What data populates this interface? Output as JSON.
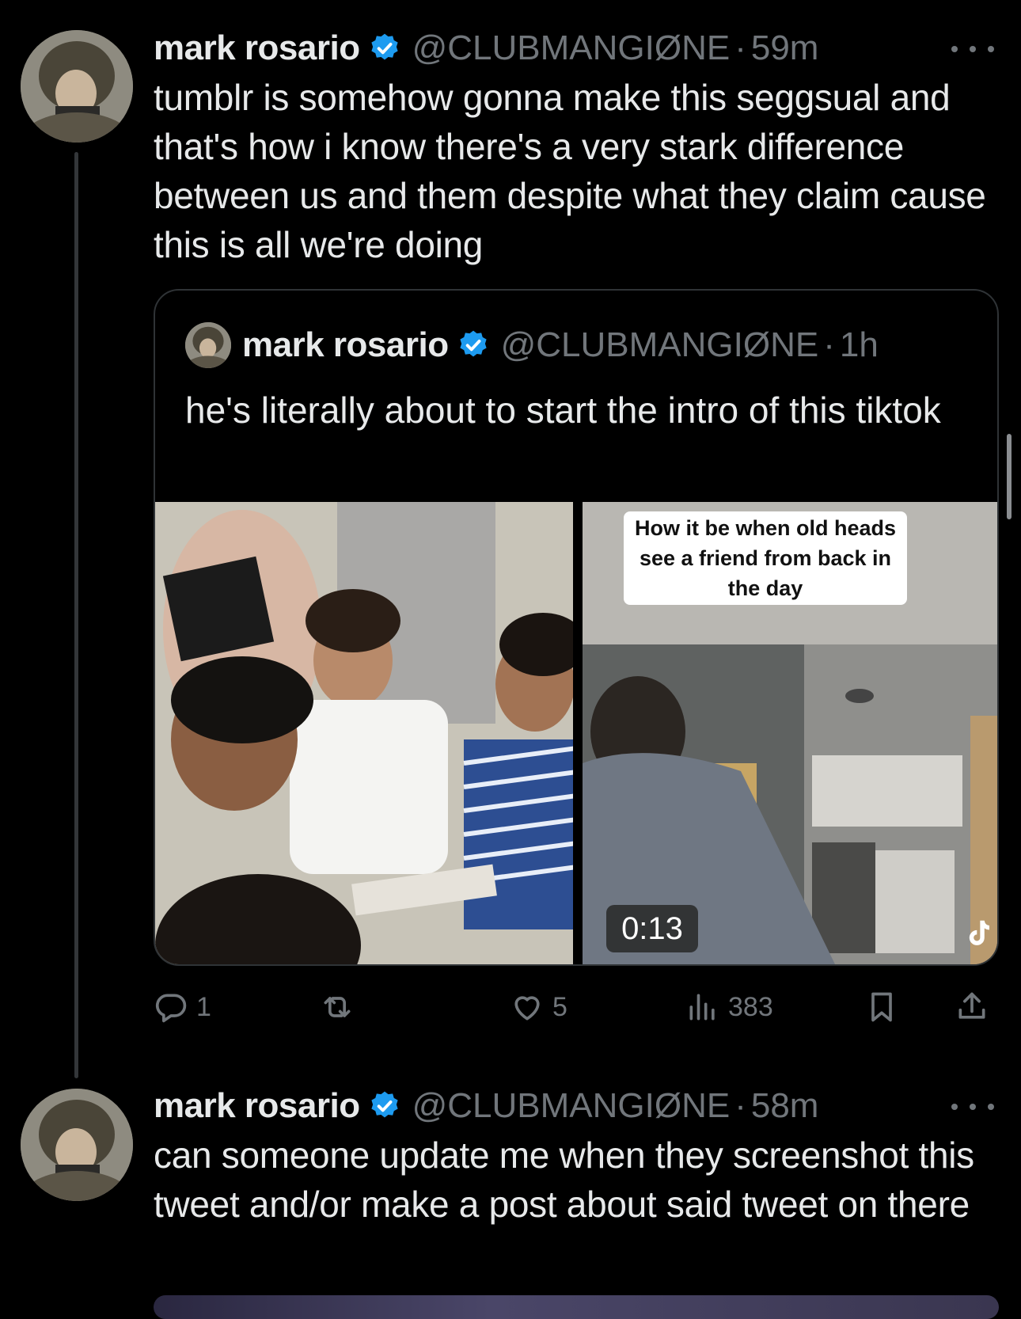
{
  "tweets": [
    {
      "display_name": "mark rosario",
      "handle": "@CLUBMANGIØNE",
      "dot": "·",
      "time": "59m",
      "text": "tumblr is somehow gonna make this seggsual and that's how i know there's a very stark difference between us and them despite what they claim cause this is all we're doing"
    },
    {
      "display_name": "mark rosario",
      "handle": "@CLUBMANGIØNE",
      "dot": "·",
      "time": "58m",
      "text": "can someone update me when they screenshot this tweet and/or make a post about said tweet on there"
    }
  ],
  "quote": {
    "display_name": "mark rosario",
    "handle": "@CLUBMANGIØNE",
    "dot": "·",
    "time": "1h",
    "text": "he's literally about to start the intro of this tiktok",
    "video_caption": "How it be when old heads see a friend from back in the day",
    "video_duration": "0:13"
  },
  "actions": {
    "replies": "1",
    "likes": "5",
    "views": "383"
  },
  "colors": {
    "background": "#000000",
    "text": "#e7e9ea",
    "muted": "#71767b",
    "verified": "#1d9bf0",
    "border": "#2f3336"
  },
  "icons": [
    "verified-badge-icon",
    "more-icon",
    "reply-icon",
    "retweet-icon",
    "like-icon",
    "views-icon",
    "bookmark-icon",
    "share-icon",
    "tiktok-icon"
  ]
}
